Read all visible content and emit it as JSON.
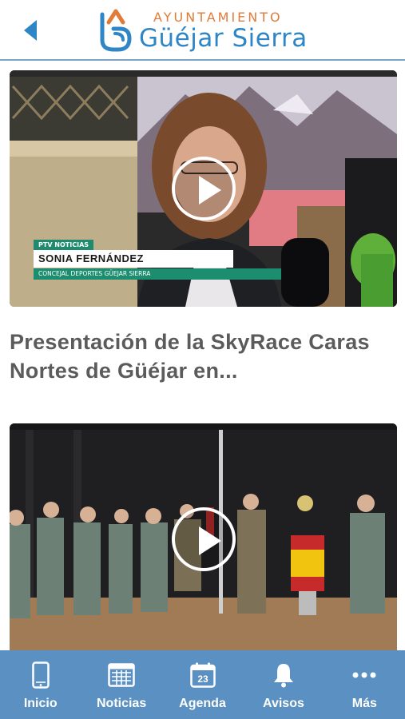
{
  "header": {
    "back_icon": "chevron-left-icon",
    "logo_top": "AYUNTAMIENTO",
    "logo_main": "Güéjar Sierra",
    "accent_orange": "#e07b39",
    "accent_blue": "#2f86c6"
  },
  "feed": {
    "items": [
      {
        "title": "Presentación de la SkyRace Caras Nortes de Güéjar en...",
        "overlay_tag": "PTV NOTICIAS",
        "overlay_name": "SONIA FERNÁNDEZ",
        "overlay_role": "CONCEJAL DEPORTES GÜEJAR SIERRA",
        "play_icon": "play-icon"
      },
      {
        "title": "",
        "play_icon": "play-icon"
      }
    ]
  },
  "tabbar": {
    "background": "#5b90c2",
    "items": [
      {
        "label": "Inicio",
        "icon": "phone-icon"
      },
      {
        "label": "Noticias",
        "icon": "newspaper-icon"
      },
      {
        "label": "Agenda",
        "icon": "calendar-icon",
        "icon_text": "23"
      },
      {
        "label": "Avisos",
        "icon": "bell-icon"
      },
      {
        "label": "Más",
        "icon": "more-icon"
      }
    ]
  }
}
